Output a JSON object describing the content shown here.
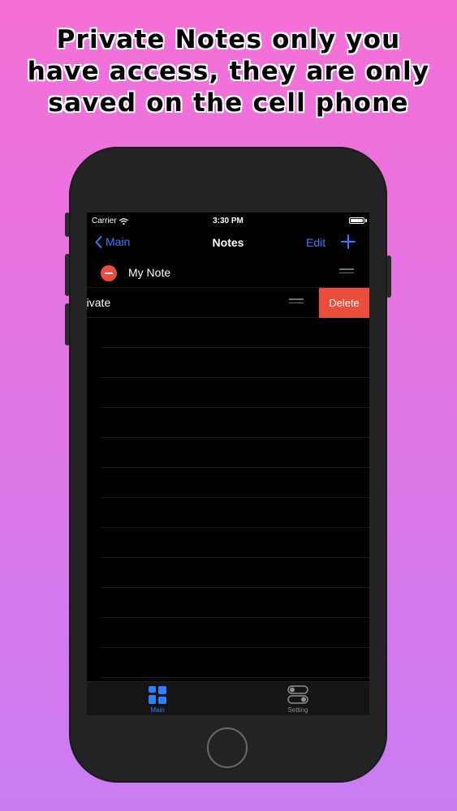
{
  "headline": {
    "line1": "Private Notes only you",
    "line2": "have access, they are only",
    "line3": "saved on the cell phone"
  },
  "status_bar": {
    "carrier": "Carrier",
    "time": "3:30 PM"
  },
  "nav": {
    "back_label": "Main",
    "title": "Notes",
    "edit_label": "Edit"
  },
  "notes": [
    {
      "label": "My Note"
    },
    {
      "label": "rivate"
    }
  ],
  "swipe_action": {
    "delete_label": "Delete"
  },
  "tabs": [
    {
      "label": "Main",
      "icon": "grid-icon",
      "active": true
    },
    {
      "label": "Setting",
      "icon": "toggles-icon",
      "active": false
    }
  ],
  "colors": {
    "accent": "#2f80ff",
    "destructive": "#eb4d3d"
  }
}
